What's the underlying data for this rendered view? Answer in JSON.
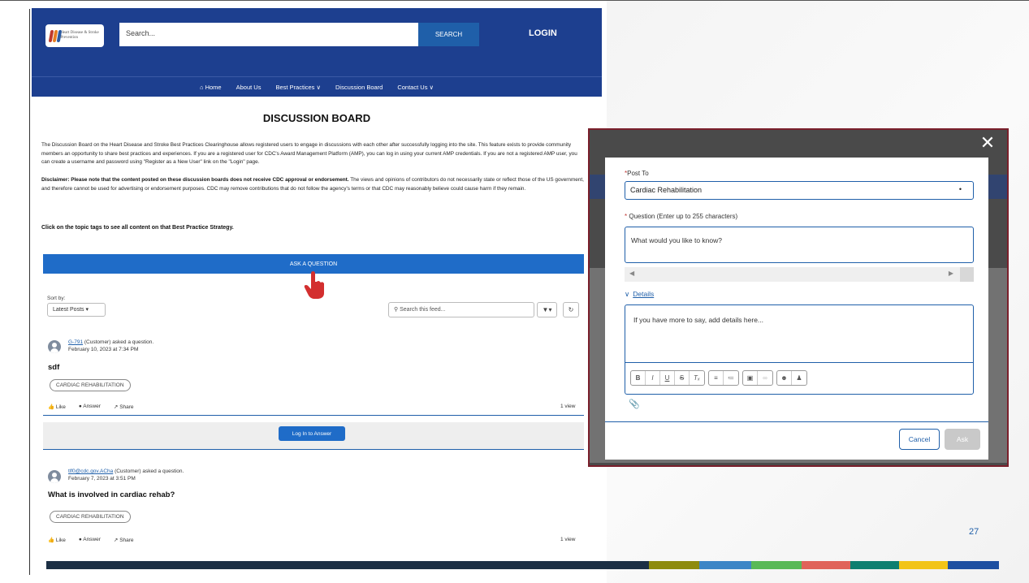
{
  "site": {
    "logo_text": "Heart Disease & Stroke Prevention",
    "search_placeholder": "Search...",
    "search_button": "SEARCH",
    "login": "LOGIN",
    "nav": {
      "home": "Home",
      "about": "About Us",
      "best_practices": "Best Practices ∨",
      "discussion": "Discussion Board",
      "contact": "Contact Us ∨"
    },
    "title": "DISCUSSION BOARD",
    "intro": "The Discussion Board on the Heart Disease and Stroke Best Practices Clearinghouse allows registered users to engage in discussions with each other after successfully logging into the site. This feature exists to provide community members an opportunity to share best practices and experiences. If you are a registered user for CDC's Award Management Platform (AMP), you can log in using your current AMP credentials. If you are not a registered AMP user, you can create a username and password using \"Register as a New User\" link on the \"Login\" page.",
    "disclaimer_bold": "Disclaimer: Please note that the content posted on these discussion boards does not receive CDC approval or endorsement.",
    "disclaimer_rest": " The views and opinions of contributors do not necessarily state or reflect those of the US government, and therefore cannot be used for advertising or endorsement purposes. CDC may remove contributions that do not follow the agency's terms or that CDC may reasonably believe could cause harm if they remain.",
    "click_note": "Click on the topic tags to see all content on that Best Practice Strategy.",
    "ask_button": "ASK A QUESTION",
    "sort_label": "Sort by:",
    "sort_value": "Latest Posts",
    "feed_search_placeholder": "Search this feed...",
    "posts": [
      {
        "user": "G-791",
        "role": " (Customer) asked a question.",
        "date": "February 10, 2023 at 7:34 PM",
        "title": "sdf",
        "tag": "CARDIAC REHABILITATION",
        "like": "Like",
        "answer": "Answer",
        "share": "Share",
        "views": "1 view"
      },
      {
        "user": "tlf0@cdc.gov.ACha",
        "role": " (Customer) asked a question.",
        "date": "February 7, 2023 at 3:51 PM",
        "title": "What is involved in cardiac rehab?",
        "tag": "CARDIAC REHABILITATION",
        "like": "Like",
        "answer": "Answer",
        "share": "Share",
        "views": "1 view"
      }
    ],
    "login_to_answer": "Log In to Answer"
  },
  "modal": {
    "post_to_label": "Post To",
    "post_to_value": "Cardiac Rehabilitation",
    "question_label": "Question (Enter up to 255 characters)",
    "question_placeholder": "What would you like to know?",
    "details_label": "Details",
    "details_placeholder": "If you have more to say, add details here...",
    "cancel": "Cancel",
    "ask": "Ask",
    "toolbar_icons": [
      "bold-icon",
      "italic-icon",
      "underline-icon",
      "strikethrough-icon",
      "clear-format-icon",
      "bullet-list-icon",
      "numbered-list-icon",
      "image-icon",
      "link-icon",
      "emoji-icon",
      "mention-icon"
    ]
  },
  "slide": {
    "page_number": "27"
  },
  "colors": {
    "brand_blue": "#1d3f8f",
    "button_blue": "#1f6cc8",
    "modal_border": "#7a1f2b"
  }
}
